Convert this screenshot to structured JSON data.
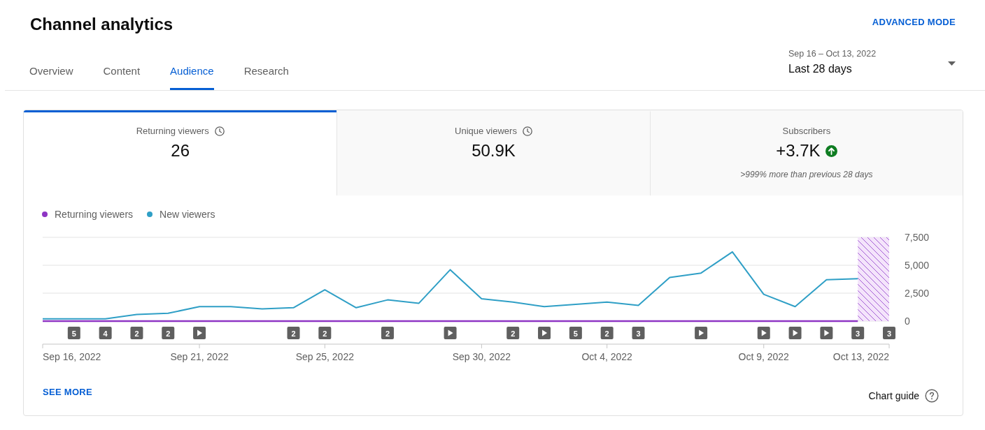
{
  "header": {
    "title": "Channel analytics",
    "action": "ADVANCED MODE"
  },
  "tabs": [
    {
      "label": "Overview",
      "selected": false
    },
    {
      "label": "Content",
      "selected": false
    },
    {
      "label": "Audience",
      "selected": true
    },
    {
      "label": "Research",
      "selected": false
    }
  ],
  "date_range": {
    "range": "Sep 16 – Oct 13, 2022",
    "period": "Last 28 days"
  },
  "metrics": [
    {
      "label": "Returning viewers",
      "value": "26",
      "selected": true,
      "kind": "timed"
    },
    {
      "label": "Unique viewers",
      "value": "50.9K",
      "selected": false,
      "kind": "timed"
    },
    {
      "label": "Subscribers",
      "value": "+3.7K",
      "selected": false,
      "kind": "trend",
      "rising": true,
      "note": ">999% more than previous 28 days"
    }
  ],
  "chart": {
    "chart_data": {
      "type": "line",
      "legend": "top",
      "x": [
        "2022-09-16",
        "2022-09-17",
        "2022-09-18",
        "2022-09-19",
        "2022-09-20",
        "2022-09-21",
        "2022-09-22",
        "2022-09-23",
        "2022-09-24",
        "2022-09-25",
        "2022-09-26",
        "2022-09-27",
        "2022-09-28",
        "2022-09-29",
        "2022-09-30",
        "2022-10-01",
        "2022-10-02",
        "2022-10-03",
        "2022-10-04",
        "2022-10-05",
        "2022-10-06",
        "2022-10-07",
        "2022-10-08",
        "2022-10-09",
        "2022-10-10",
        "2022-10-11",
        "2022-10-12"
      ],
      "xlim": [
        "2022-09-16",
        "2022-10-13"
      ],
      "xticks": [
        {
          "value": "2022-09-16",
          "label": "Sep 16, 2022"
        },
        {
          "value": "2022-09-21",
          "label": "Sep 21, 2022"
        },
        {
          "value": "2022-09-25",
          "label": "Sep 25, 2022"
        },
        {
          "value": "2022-09-30",
          "label": "Sep 30, 2022"
        },
        {
          "value": "2022-10-04",
          "label": "Oct 4, 2022"
        },
        {
          "value": "2022-10-09",
          "label": "Oct 9, 2022"
        },
        {
          "value": "2022-10-13",
          "label": "Oct 13, 2022"
        }
      ],
      "ylim": [
        0,
        7500
      ],
      "yticks": [
        {
          "value": 0,
          "label": "0"
        },
        {
          "value": 2500,
          "label": "2,500"
        },
        {
          "value": 5000,
          "label": "5,000"
        },
        {
          "value": 7500,
          "label": "7,500"
        }
      ],
      "series": [
        {
          "name": "Returning viewers",
          "color": "#8e35c4",
          "values": [
            0,
            0,
            0,
            0,
            0,
            0,
            0,
            0,
            0,
            0,
            0,
            0,
            0,
            0,
            0,
            0,
            0,
            0,
            0,
            0,
            0,
            0,
            0,
            0,
            0,
            0,
            0
          ]
        },
        {
          "name": "New viewers",
          "color": "#2f9fc6",
          "values": [
            200,
            200,
            200,
            600,
            700,
            1300,
            1300,
            1100,
            1200,
            2800,
            1200,
            1900,
            1600,
            4600,
            2000,
            1700,
            1300,
            1500,
            1700,
            1400,
            3900,
            4300,
            6200,
            2400,
            1300,
            3700,
            3800
          ]
        }
      ],
      "bands": [
        {
          "axis": "x",
          "from": "2022-10-12",
          "to": "2022-10-13"
        }
      ]
    },
    "upload_markers": [
      {
        "kind": "none"
      },
      {
        "kind": "count",
        "label": "5"
      },
      {
        "kind": "count",
        "label": "4"
      },
      {
        "kind": "count",
        "label": "2"
      },
      {
        "kind": "count",
        "label": "2"
      },
      {
        "kind": "video"
      },
      {
        "kind": "none"
      },
      {
        "kind": "none"
      },
      {
        "kind": "count",
        "label": "2"
      },
      {
        "kind": "count",
        "label": "2"
      },
      {
        "kind": "none"
      },
      {
        "kind": "count",
        "label": "2"
      },
      {
        "kind": "none"
      },
      {
        "kind": "video"
      },
      {
        "kind": "none"
      },
      {
        "kind": "count",
        "label": "2"
      },
      {
        "kind": "video"
      },
      {
        "kind": "count",
        "label": "5"
      },
      {
        "kind": "count",
        "label": "2"
      },
      {
        "kind": "count",
        "label": "3"
      },
      {
        "kind": "none"
      },
      {
        "kind": "video"
      },
      {
        "kind": "none"
      },
      {
        "kind": "video"
      },
      {
        "kind": "video"
      },
      {
        "kind": "video"
      },
      {
        "kind": "count",
        "label": "3"
      },
      {
        "kind": "count",
        "label": "3"
      }
    ]
  },
  "footer": {
    "link": "SEE MORE",
    "guide": "Chart guide"
  }
}
